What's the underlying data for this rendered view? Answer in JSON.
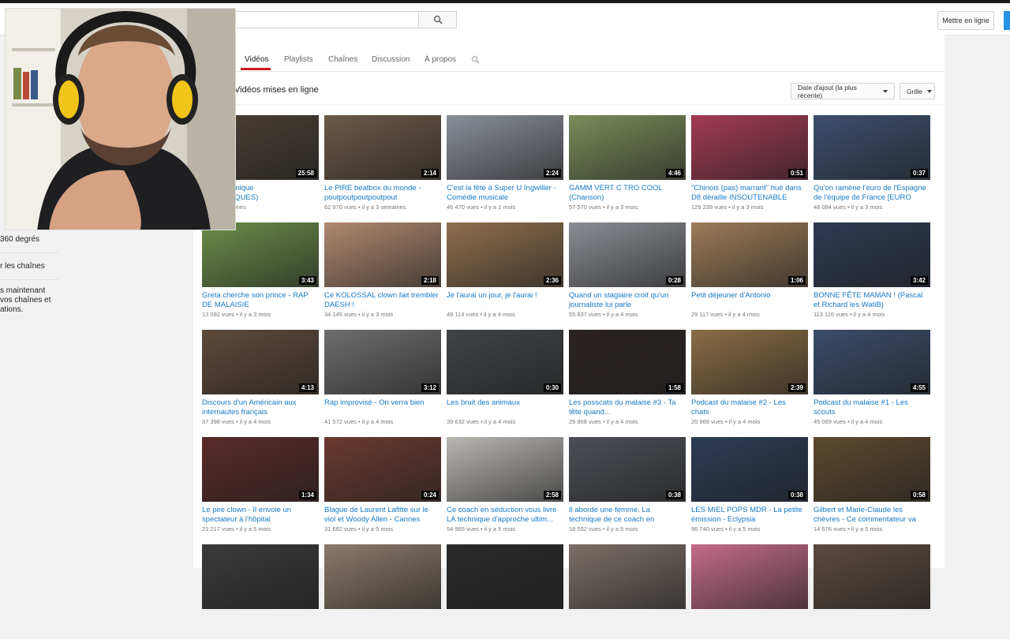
{
  "masthead": {
    "upload_label": "Mettre en ligne"
  },
  "left_nav": {
    "items": [
      "360 degrés",
      "r les chaînes",
      "s maintenant",
      "vos chaînes et",
      "ations."
    ]
  },
  "tabs": [
    "Vidéos",
    "Playlists",
    "Chaînes",
    "Discussion",
    "À propos"
  ],
  "section": {
    "title": "Vidéos mises en ligne",
    "sort_label": "Date d'ajout (la plus récente)",
    "view_label": "Grille"
  },
  "videos": [
    {
      "title1": "ASE - Comique",
      "title2": "es BIDESQUES)",
      "views": "",
      "age": "il y a 3 semaines",
      "duration": "25:58",
      "bg": "#4a4036"
    },
    {
      "title1": "Le PIRE beatbox du monde -",
      "title2": "poutpoutpoutpoutpout",
      "views": "62 970 vues",
      "age": "il y a 3 semaines",
      "duration": "2:14",
      "bg": "#6b5a48"
    },
    {
      "title1": "C'est la fête à Super U Ingwiller -",
      "title2": "Comédie musicale",
      "views": "46 470 vues",
      "age": "il y a 1 mois",
      "duration": "2:24",
      "bg": "#8a8f98"
    },
    {
      "title1": "GAMM VERT C TRO COOL",
      "title2": "(Chanson)",
      "views": "57 570 vues",
      "age": "il y a 3 mois",
      "duration": "4:46",
      "bg": "#7b8c5a"
    },
    {
      "title1": "\"Chinois (pas) marrant\" hué dans",
      "title2": "D8 déraille INSOUTENABLE",
      "views": "129 239 vues",
      "age": "il y a 3 mois",
      "duration": "0:51",
      "bg": "#a33a55"
    },
    {
      "title1": "Qu'on ramène l'euro de l'Espagne",
      "title2": "de l'équipe de France [EURO",
      "views": "48 084 vues",
      "age": "il y a 3 mois",
      "duration": "0:37",
      "bg": "#3d4f6e"
    },
    {
      "title1": "Greta cherche son prince - RAP",
      "title2": "DE MALAISIE",
      "views": "13 092 vues",
      "age": "il y a 3 mois",
      "duration": "3:43",
      "bg": "#6c8e4a"
    },
    {
      "title1": "Ce KOLOSSAL clown fait trembler",
      "title2": "DAESH !",
      "views": "34 145 vues",
      "age": "il y a 3 mois",
      "duration": "2:18",
      "bg": "#b08970"
    },
    {
      "title1": "Je l'aurai un jour, je l'aurai !",
      "title2": "",
      "views": "49 114 vues",
      "age": "il y a 4 mois",
      "duration": "2:36",
      "bg": "#8f6f4e"
    },
    {
      "title1": "Quand un stagiaire croit qu'un",
      "title2": "journaliste lui parle",
      "views": "55 837 vues",
      "age": "il y a 4 mois",
      "duration": "0:28",
      "bg": "#8a8d93"
    },
    {
      "title1": "Petit déjeuner d'Antonio",
      "title2": "",
      "views": "29 117 vues",
      "age": "il y a 4 mois",
      "duration": "1:06",
      "bg": "#9c7b58"
    },
    {
      "title1": "BONNE FÊTE MAMAN ! (Pascal",
      "title2": "et Richard les WatiB)",
      "views": "113 116 vues",
      "age": "il y a 4 mois",
      "duration": "3:42",
      "bg": "#2f3a52"
    },
    {
      "title1": "Discours d'un Américain aux",
      "title2": "internautes français",
      "views": "37 398 vues",
      "age": "il y a 4 mois",
      "duration": "4:13",
      "bg": "#5e4a3a"
    },
    {
      "title1": "Rap improvisé - On verra bien",
      "title2": "",
      "views": "41 572 vues",
      "age": "il y a 4 mois",
      "duration": "3:12",
      "bg": "#6e6e70"
    },
    {
      "title1": "Les bruit des animaux",
      "title2": "",
      "views": "39 632 vues",
      "age": "il y a 4 mois",
      "duration": "0:30",
      "bg": "#3f4447"
    },
    {
      "title1": "Les posscats du malaise #3 - Ta",
      "title2": "tête quand...",
      "views": "29 868 vues",
      "age": "il y a 4 mois",
      "duration": "1:58",
      "bg": "#2a2321"
    },
    {
      "title1": "Podcast du malaise #2 - Les",
      "title2": "chats",
      "views": "20 969 vues",
      "age": "il y a 4 mois",
      "duration": "2:39",
      "bg": "#8a6d45"
    },
    {
      "title1": "Podcast du malaise #1 - Les",
      "title2": "scouts",
      "views": "45 069 vues",
      "age": "il y a 4 mois",
      "duration": "4:55",
      "bg": "#3b4d6a"
    },
    {
      "title1": "Le pire clown - Il envoie un",
      "title2": "spectateur à l'hôpital",
      "views": "23 217 vues",
      "age": "il y a 5 mois",
      "duration": "1:34",
      "bg": "#5a2a2a"
    },
    {
      "title1": "Blague de Laurent Lafitte sur le",
      "title2": "viol et Woody Allen - Cannes",
      "views": "31 682 vues",
      "age": "il y a 5 mois",
      "duration": "0:24",
      "bg": "#6b3a30"
    },
    {
      "title1": "Ce coach en séduction vous livre",
      "title2": "LA technique d'approche ultim...",
      "views": "54 965 vues",
      "age": "il y a 5 mois",
      "duration": "2:58",
      "bg": "#b9b7b2"
    },
    {
      "title1": "Il aborde une femme. La",
      "title2": "technique de ce coach en",
      "views": "18 552 vues",
      "age": "il y a 5 mois",
      "duration": "0:38",
      "bg": "#4b4f55"
    },
    {
      "title1": "LES MIEL POPS MDR - La petite",
      "title2": "émission - Eclypsia",
      "views": "96 740 vues",
      "age": "il y a 5 mois",
      "duration": "0:38",
      "bg": "#2d3c55"
    },
    {
      "title1": "Gilbert et Marie-Claude les",
      "title2": "chèvres - Ce commentateur va",
      "views": "14 676 vues",
      "age": "il y a 5 mois",
      "duration": "0:58",
      "bg": "#5b4a2f"
    },
    {
      "title1": "",
      "title2": "",
      "views": "",
      "age": "",
      "duration": "",
      "bg": "#3a3a3a"
    },
    {
      "title1": "",
      "title2": "",
      "views": "",
      "age": "",
      "duration": "",
      "bg": "#8a7b6b"
    },
    {
      "title1": "",
      "title2": "",
      "views": "",
      "age": "",
      "duration": "",
      "bg": "#2a2a2a"
    },
    {
      "title1": "",
      "title2": "",
      "views": "",
      "age": "",
      "duration": "",
      "bg": "#7a6f68"
    },
    {
      "title1": "",
      "title2": "",
      "views": "",
      "age": "",
      "duration": "",
      "bg": "#c46b8a"
    },
    {
      "title1": "",
      "title2": "",
      "views": "",
      "age": "",
      "duration": "",
      "bg": "#5a4b40"
    }
  ],
  "colors": {
    "accent": "#cc181e",
    "link": "#167ac6"
  }
}
